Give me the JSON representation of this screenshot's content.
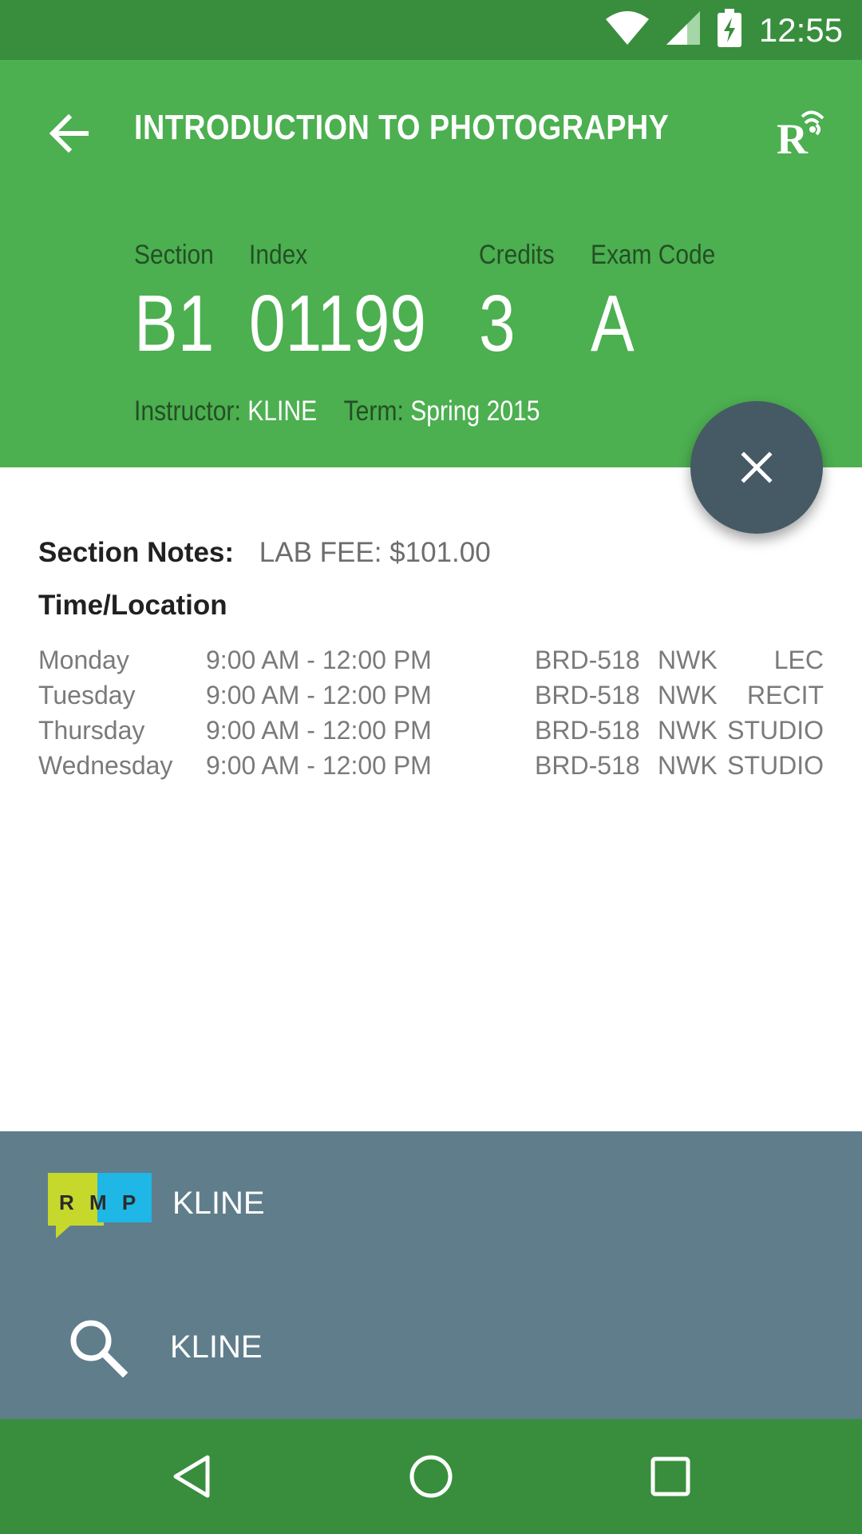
{
  "status_bar": {
    "time": "12:55"
  },
  "header": {
    "title": "INTRODUCTION TO PHOTOGRAPHY",
    "fields": [
      {
        "label": "Section",
        "value": "B1"
      },
      {
        "label": "Index",
        "value": "01199"
      },
      {
        "label": "Credits",
        "value": "3"
      },
      {
        "label": "Exam Code",
        "value": "A"
      }
    ],
    "instructor_label": "Instructor:",
    "instructor": "KLINE",
    "term_label": "Term:",
    "term": "Spring 2015"
  },
  "notes": {
    "label": "Section Notes:",
    "value": "LAB FEE: $101.00"
  },
  "time_location": {
    "title": "Time/Location",
    "rows": [
      {
        "day": "Monday",
        "time": "9:00 AM - 12:00 PM",
        "room": "BRD-518",
        "campus": "NWK",
        "type": "LEC"
      },
      {
        "day": "Tuesday",
        "time": "9:00 AM - 12:00 PM",
        "room": "BRD-518",
        "campus": "NWK",
        "type": "RECIT"
      },
      {
        "day": "Thursday",
        "time": "9:00 AM - 12:00 PM",
        "room": "BRD-518",
        "campus": "NWK",
        "type": "STUDIO"
      },
      {
        "day": "Wednesday",
        "time": "9:00 AM - 12:00 PM",
        "room": "BRD-518",
        "campus": "NWK",
        "type": "STUDIO"
      }
    ]
  },
  "instructor_actions": {
    "rmp_logo_text": "R M P",
    "rmp_label": "KLINE",
    "search_label": "KLINE"
  },
  "icons": {
    "back": "arrow-left-icon",
    "app": "rutgers-radio-icon",
    "fab": "close-icon",
    "rmp": "rmp-logo",
    "search": "search-icon",
    "nav_back": "triangle-back-icon",
    "nav_home": "circle-home-icon",
    "nav_recents": "square-recents-icon"
  },
  "colors": {
    "status_bar": "#388e3c",
    "header": "#4caf50",
    "fab": "#455a64",
    "bottom_panel": "#607d8b",
    "rmp_yellow": "#c6d82b",
    "rmp_blue": "#1eb7e6"
  }
}
